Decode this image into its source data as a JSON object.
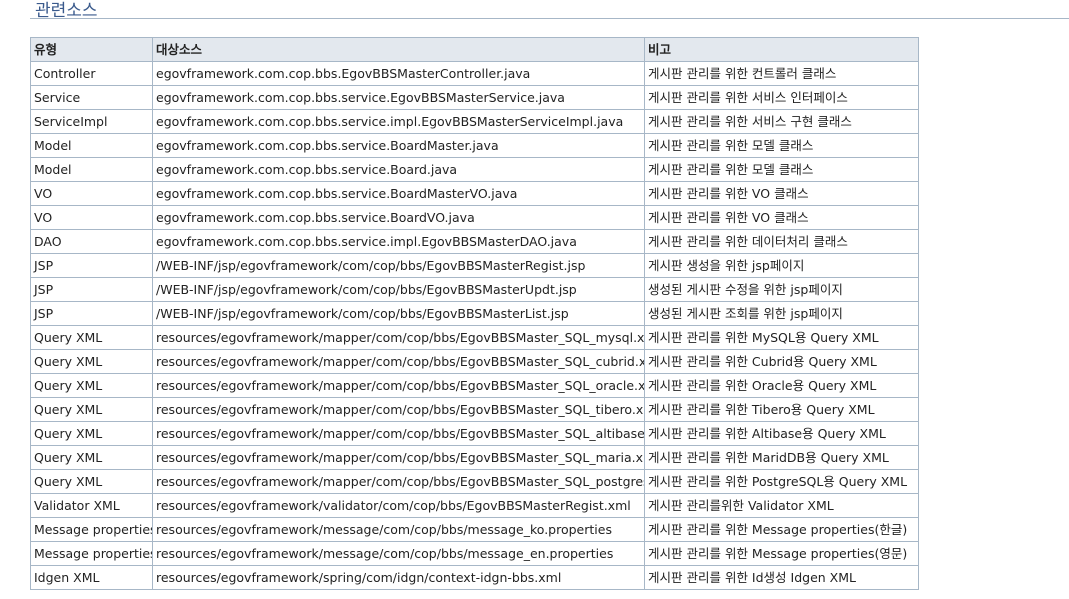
{
  "section": {
    "title": "관련소스"
  },
  "table": {
    "headers": [
      "유형",
      "대상소스",
      "비고"
    ],
    "rows": [
      [
        "Controller",
        "egovframework.com.cop.bbs.EgovBBSMasterController.java",
        "게시판 관리를 위한 컨트롤러 클래스"
      ],
      [
        "Service",
        "egovframework.com.cop.bbs.service.EgovBBSMasterService.java",
        "게시판 관리를 위한 서비스 인터페이스"
      ],
      [
        "ServiceImpl",
        "egovframework.com.cop.bbs.service.impl.EgovBBSMasterServiceImpl.java",
        "게시판 관리를 위한 서비스 구현 클래스"
      ],
      [
        "Model",
        "egovframework.com.cop.bbs.service.BoardMaster.java",
        "게시판 관리를 위한 모델 클래스"
      ],
      [
        "Model",
        "egovframework.com.cop.bbs.service.Board.java",
        "게시판 관리를 위한 모델 클래스"
      ],
      [
        "VO",
        "egovframework.com.cop.bbs.service.BoardMasterVO.java",
        "게시판 관리를 위한 VO 클래스"
      ],
      [
        "VO",
        "egovframework.com.cop.bbs.service.BoardVO.java",
        "게시판 관리를 위한 VO 클래스"
      ],
      [
        "DAO",
        "egovframework.com.cop.bbs.service.impl.EgovBBSMasterDAO.java",
        "게시판 관리를 위한 데이터처리 클래스"
      ],
      [
        "JSP",
        "/WEB-INF/jsp/egovframework/com/cop/bbs/EgovBBSMasterRegist.jsp",
        "게시판 생성을 위한 jsp페이지"
      ],
      [
        "JSP",
        "/WEB-INF/jsp/egovframework/com/cop/bbs/EgovBBSMasterUpdt.jsp",
        "생성된 게시판 수정을 위한 jsp페이지"
      ],
      [
        "JSP",
        "/WEB-INF/jsp/egovframework/com/cop/bbs/EgovBBSMasterList.jsp",
        "생성된 게시판 조회를 위한 jsp페이지"
      ],
      [
        "Query XML",
        "resources/egovframework/mapper/com/cop/bbs/EgovBBSMaster_SQL_mysql.xml",
        "게시판 관리를 위한 MySQL용 Query XML"
      ],
      [
        "Query XML",
        "resources/egovframework/mapper/com/cop/bbs/EgovBBSMaster_SQL_cubrid.xml",
        "게시판 관리를 위한 Cubrid용 Query XML"
      ],
      [
        "Query XML",
        "resources/egovframework/mapper/com/cop/bbs/EgovBBSMaster_SQL_oracle.xml",
        "게시판 관리를 위한 Oracle용 Query XML"
      ],
      [
        "Query XML",
        "resources/egovframework/mapper/com/cop/bbs/EgovBBSMaster_SQL_tibero.xml",
        "게시판 관리를 위한 Tibero용 Query XML"
      ],
      [
        "Query XML",
        "resources/egovframework/mapper/com/cop/bbs/EgovBBSMaster_SQL_altibase.xml",
        "게시판 관리를 위한 Altibase용 Query XML"
      ],
      [
        "Query XML",
        "resources/egovframework/mapper/com/cop/bbs/EgovBBSMaster_SQL_maria.xml",
        "게시판 관리를 위한 MaridDB용 Query XML"
      ],
      [
        "Query XML",
        "resources/egovframework/mapper/com/cop/bbs/EgovBBSMaster_SQL_postgres.xml",
        "게시판 관리를 위한 PostgreSQL용 Query XML"
      ],
      [
        "Validator XML",
        "resources/egovframework/validator/com/cop/bbs/EgovBBSMasterRegist.xml",
        "게시판 관리를위한 Validator XML"
      ],
      [
        "Message properties",
        "resources/egovframework/message/com/cop/bbs/message_ko.properties",
        "게시판 관리를 위한 Message properties(한글)"
      ],
      [
        "Message properties",
        "resources/egovframework/message/com/cop/bbs/message_en.properties",
        "게시판 관리를 위한 Message properties(영문)"
      ],
      [
        "Idgen XML",
        "resources/egovframework/spring/com/idgn/context-idgn-bbs.xml",
        "게시판 관리를 위한 Id생성 Idgen XML"
      ]
    ]
  }
}
